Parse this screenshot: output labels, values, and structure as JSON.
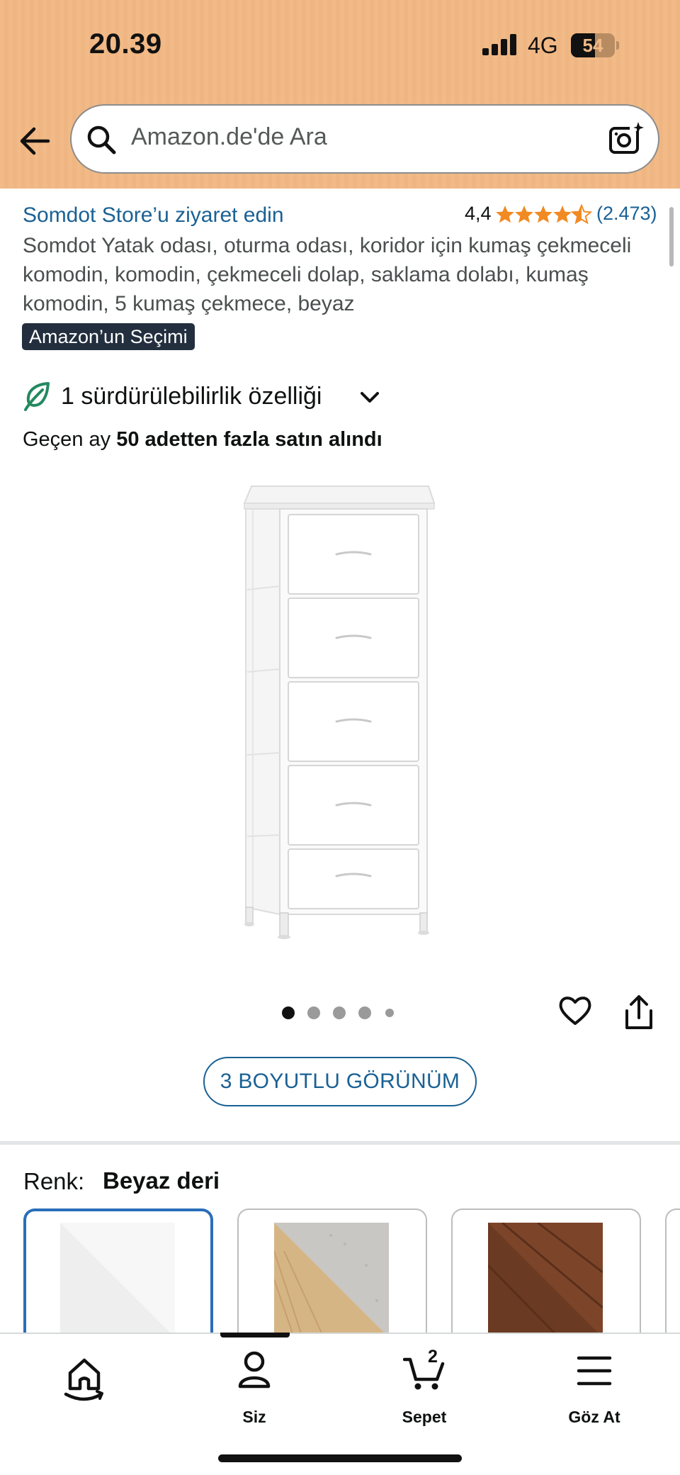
{
  "status_bar": {
    "time": "20.39",
    "network": "4G",
    "battery": "54"
  },
  "search": {
    "placeholder": "Amazon.de'de Ara"
  },
  "product": {
    "store_link": "Somdot Store’u ziyaret edin",
    "rating": "4,4",
    "stars": 4.5,
    "review_count": "(2.473)",
    "title": "Somdot Yatak odası, oturma odası, koridor için kumaş çekmeceli komodin, komodin, çekmeceli dolap, saklama dolabı, kumaş komodin, 5 kumaş çekmece, beyaz",
    "badge": "Amazon’un Seçimi",
    "sustainability": "1 sürdürülebilirlik özelliği",
    "bought_prefix": "Geçen ay ",
    "bought_bold": "50 adetten fazla satın alındı",
    "image_count": 5,
    "active_image": 1,
    "view_3d": "3 BOYUTLU GÖRÜNÜM"
  },
  "color": {
    "label": "Renk:",
    "selected": "Beyaz deri",
    "options": [
      "white",
      "oak-grey",
      "rustic-brown"
    ]
  },
  "bottom_nav": {
    "home": "",
    "you": "Siz",
    "cart": "Sepet",
    "cart_count": "2",
    "browse": "Göz At"
  },
  "colors": {
    "header": "#f1ba86",
    "link": "#1a6194",
    "star": "#f18a23",
    "badge": "#232f3e",
    "sustain": "#23895f"
  }
}
